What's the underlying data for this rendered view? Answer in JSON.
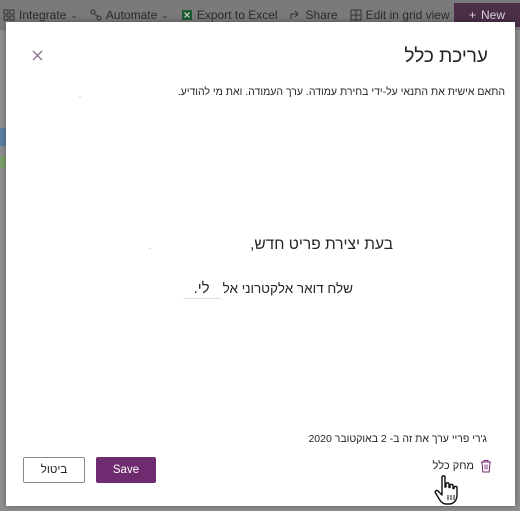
{
  "toolbar": {
    "new_label": "New",
    "edit_grid_label": "Edit in grid view",
    "share_label": "Share",
    "export_label": "Export to Excel",
    "automate_label": "Automate",
    "integrate_label": "Integrate"
  },
  "dialog": {
    "title": "עריכת כלל",
    "instructions": "התאם אישית את התנאי על-ידי בחירת עמודה. ערך העמודה. ואת מי להודיע.",
    "rule_heading": "בעת יצירת פריט חדש,",
    "rule_text": "שלח דואר אלקטרוני אל",
    "rule_token": "לי.",
    "author_line": "ג'רי פריי ערך את זה ב- 2 באוקטובר 2020",
    "delete_label": "מחק כלל",
    "save_label": "Save",
    "cancel_label": "ביטול"
  },
  "icons": {
    "close": "close-icon",
    "delete": "trash-icon",
    "cursor": "hand-cursor-icon"
  },
  "colors": {
    "accent": "#6f2b6f",
    "close_icon": "#8a6d8a",
    "text": "#252423"
  }
}
